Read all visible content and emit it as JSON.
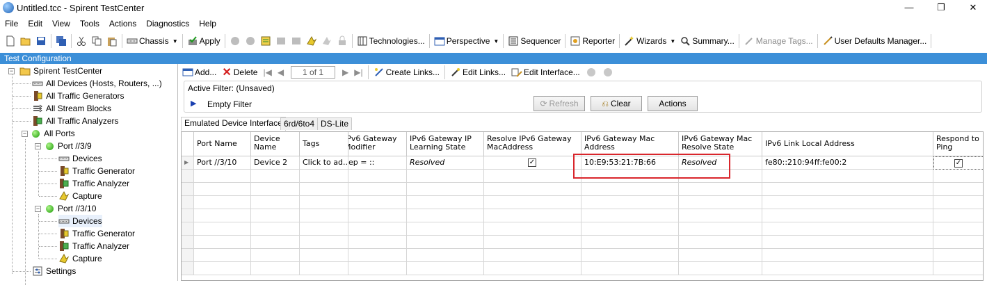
{
  "window": {
    "title": "Untitled.tcc - Spirent TestCenter",
    "minimize": "—",
    "maximize": "❐",
    "close": "✕"
  },
  "menu": [
    "File",
    "Edit",
    "View",
    "Tools",
    "Actions",
    "Diagnostics",
    "Help"
  ],
  "toolbar": {
    "chassis": "Chassis",
    "apply": "Apply",
    "technologies": "Technologies...",
    "perspective": "Perspective",
    "sequencer": "Sequencer",
    "reporter": "Reporter",
    "wizards": "Wizards",
    "summary": "Summary...",
    "manage_tags": "Manage Tags...",
    "user_defaults": "User Defaults Manager..."
  },
  "panel": {
    "title": "Test Configuration"
  },
  "tree": {
    "root": "Spirent TestCenter",
    "all_devices": "All Devices (Hosts, Routers, ...)",
    "all_traffic_generators": "All Traffic Generators",
    "all_stream_blocks": "All Stream Blocks",
    "all_traffic_analyzers": "All Traffic Analyzers",
    "all_ports": "All Ports",
    "port1": {
      "name": "Port //3/9",
      "devices": "Devices",
      "traffic_generator": "Traffic Generator",
      "traffic_analyzer": "Traffic Analyzer",
      "capture": "Capture"
    },
    "port2": {
      "name": "Port //3/10",
      "devices": "Devices",
      "traffic_generator": "Traffic Generator",
      "traffic_analyzer": "Traffic Analyzer",
      "capture": "Capture"
    },
    "settings": "Settings"
  },
  "right_toolbar": {
    "add": "Add...",
    "delete": "Delete",
    "page": "1 of 1",
    "create_links": "Create Links...",
    "edit_links": "Edit Links...",
    "edit_interface": "Edit Interface..."
  },
  "filter": {
    "active_filter": "Active Filter:  (Unsaved)",
    "empty_filter": "Empty Filter",
    "refresh": "Refresh",
    "clear": "Clear",
    "actions": "Actions"
  },
  "tabs": [
    "Emulated Device Interface",
    "6rd/6to4",
    "DS-Lite"
  ],
  "grid": {
    "headers": {
      "port_name": "Port Name",
      "device_name": "Device Name",
      "tags": "Tags",
      "gateway_modifier": "IPv6 Gateway Modifier",
      "gateway_ip_learning": "IPv6 Gateway IP Learning State",
      "resolve_mac": "Resolve IPv6 Gateway MacAddress",
      "gateway_mac": "IPv6 Gateway Mac Address",
      "gateway_mac_state": "IPv6 Gateway Mac Resolve State",
      "link_local": "IPv6 Link Local Address",
      "respond_ping": "Respond to Ping"
    },
    "row": {
      "port_name": "Port //3/10",
      "device_name": "Device 2",
      "tags": "Click to ad...",
      "gateway_modifier": "ep = ::",
      "gateway_ip_learning": "Resolved",
      "resolve_mac": true,
      "gateway_mac": "10:E9:53:21:7B:66",
      "gateway_mac_state": "Resolved",
      "link_local": "fe80::210:94ff:fe00:2",
      "respond_ping": true
    }
  },
  "colors": {
    "panel_header": "#3c8fd8",
    "highlight_box": "#d9262c",
    "port_status": "#1a9a06"
  }
}
